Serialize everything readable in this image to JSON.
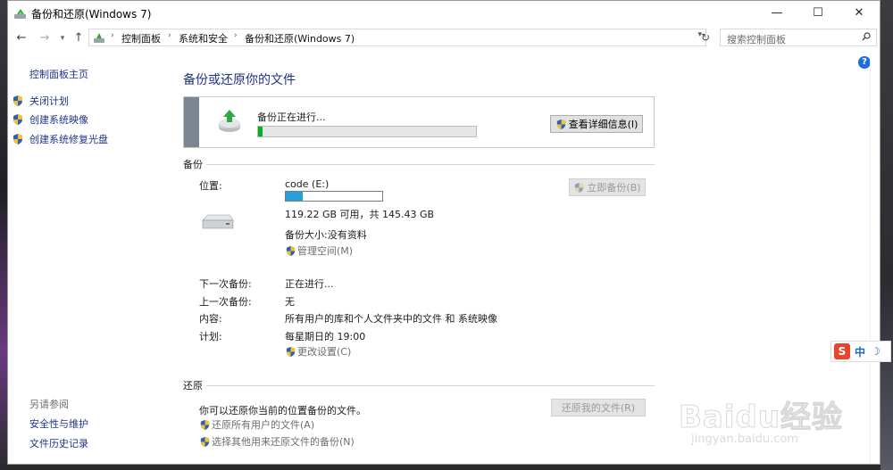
{
  "window": {
    "title": "备份和还原(Windows 7)",
    "controls": {
      "minimize": "—",
      "maximize": "☐",
      "close": "✕"
    }
  },
  "nav": {
    "breadcrumb": [
      "控制面板",
      "系统和安全",
      "备份和还原(Windows 7)"
    ],
    "search_placeholder": "搜索控制面板"
  },
  "sidebar": {
    "home": "控制面板主页",
    "items": [
      {
        "label": "关闭计划",
        "icon": "shield-icon"
      },
      {
        "label": "创建系统映像",
        "icon": "shield-icon"
      },
      {
        "label": "创建系统修复光盘",
        "icon": "shield-icon"
      }
    ],
    "see_also": "另请参阅",
    "see_also_links": [
      "安全性与维护",
      "文件历史记录"
    ]
  },
  "main": {
    "title": "备份或还原你的文件",
    "progress": {
      "status": "备份正在进行...",
      "fraction": 0.02,
      "details_button": "查看详细信息(I)"
    },
    "backup": {
      "heading": "备份",
      "location_label": "位置:",
      "drive_name": "code (E:)",
      "drive_used_fraction": 0.18,
      "free_space": "119.22 GB 可用，共 145.43 GB",
      "backup_size": "备份大小:没有资料",
      "manage_space": "管理空间(M)",
      "backup_now_button": "立即备份(B)",
      "rows": [
        {
          "label": "下一次备份:",
          "value": "正在进行..."
        },
        {
          "label": "上一次备份:",
          "value": "无"
        },
        {
          "label": "内容:",
          "value": "所有用户的库和个人文件夹中的文件 和 系统映像"
        },
        {
          "label": "计划:",
          "value": "每星期日的 19:00"
        }
      ],
      "change_settings": "更改设置(C)"
    },
    "restore": {
      "heading": "还原",
      "description": "你可以还原你当前的位置备份的文件。",
      "restore_button": "还原我的文件(R)",
      "links": [
        "还原所有用户的文件(A)",
        "选择其他用来还原文件的备份(N)"
      ]
    }
  },
  "ime": {
    "lang": "中",
    "logo": "S"
  },
  "watermark": {
    "main": "Baidu经验",
    "sub": "jingyan.baidu.com"
  },
  "colors": {
    "link": "#1e3287",
    "progress": "#06b025",
    "capacity": "#26a0da"
  }
}
